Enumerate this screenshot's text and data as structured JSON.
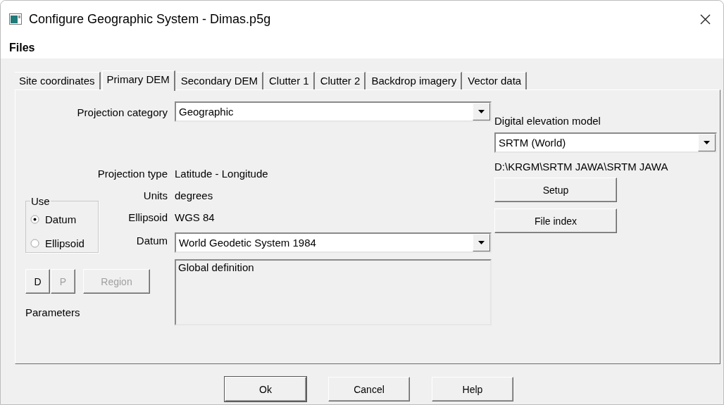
{
  "window": {
    "title": "Configure Geographic System - Dimas.p5g"
  },
  "menu": [
    {
      "label": "Files"
    }
  ],
  "tabs": [
    {
      "label": "Site coordinates",
      "selected": false
    },
    {
      "label": "Primary DEM",
      "selected": true
    },
    {
      "label": "Secondary DEM",
      "selected": false
    },
    {
      "label": "Clutter 1",
      "selected": false
    },
    {
      "label": "Clutter 2",
      "selected": false
    },
    {
      "label": "Backdrop imagery",
      "selected": false
    },
    {
      "label": "Vector data",
      "selected": false
    }
  ],
  "projection": {
    "category_label": "Projection category",
    "category": "Geographic",
    "type_label": "Projection type",
    "type": "Latitude - Longitude",
    "units_label": "Units",
    "units": "degrees",
    "ellipsoid_label": "Ellipsoid",
    "ellipsoid": "WGS 84",
    "datum_label": "Datum",
    "datum": "World Geodetic System 1984",
    "description": "Global definition"
  },
  "use_group": {
    "title": "Use",
    "options": [
      {
        "label": "Datum",
        "selected": true
      },
      {
        "label": "Ellipsoid",
        "selected": false
      }
    ]
  },
  "parameter_buttons": [
    {
      "label": "D",
      "disabled": false
    },
    {
      "label": "P",
      "disabled": true
    },
    {
      "label": "Region",
      "disabled": true
    }
  ],
  "parameters_label": "Parameters",
  "dem": {
    "label": "Digital elevation model",
    "model": "SRTM (World)",
    "path": "D:\\KRGM\\SRTM JAWA\\SRTM JAWA",
    "buttons": [
      "Setup",
      "File index"
    ]
  },
  "buttons": [
    {
      "label": "Ok",
      "default": true
    },
    {
      "label": "Cancel",
      "default": false
    },
    {
      "label": "Help",
      "default": false
    }
  ]
}
